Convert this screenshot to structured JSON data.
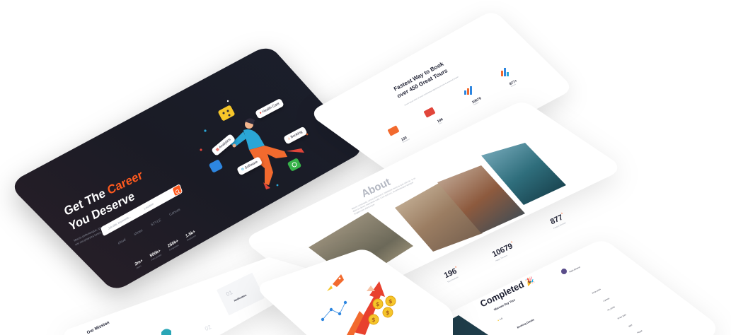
{
  "hero": {
    "title_line1": "Get The ",
    "title_accent": "Career",
    "title_line2": "You Deserve",
    "subtitle": "Mauris pellentesque, ipsum eu pulvinar laoreet, lacus lorem semper dapibus, nisi nisl pharetra lorem, nec dictum arcu nisl eget magna.",
    "search_placeholder": "Job title, keywords...",
    "location_placeholder": "Location",
    "search_icon": "search-icon",
    "brands": [
      "cloud",
      "shoes",
      "STYLE",
      "Canvas"
    ],
    "stats": [
      {
        "num": "2m+",
        "label": "Users"
      },
      {
        "num": "500k+",
        "label": "Jobs posted"
      },
      {
        "num": "250k+",
        "label": "Companies"
      },
      {
        "num": "1.5k+",
        "label": "Employers"
      }
    ],
    "tags": [
      "Health Care",
      "Booking",
      "Analytics",
      "Software"
    ]
  },
  "tour": {
    "title_line1": "Fastest Way to Book",
    "title_line2": "over 450 Great Tours",
    "subtitle": "Lorem ipsum dolor sit amet consectetur adipiscing elit sed do eiusmod tempor",
    "stats": [
      {
        "num": "130",
        "label": "Destinations"
      },
      {
        "num": "196",
        "label": "Tours"
      },
      {
        "num": "10679",
        "label": "Travelers"
      },
      {
        "num": "877+",
        "label": "Reviews"
      }
    ]
  },
  "about": {
    "title": "About",
    "subtitle": "Mauris consequat, cursus pharetra et, habitasse rhoncus quis odio ac. In et dolor eu donec maecenas nulla. Cum sed orci, sit pellentesque quisque feugiat cras ullamcorper.",
    "stats": [
      {
        "num": "196",
        "sup": "+",
        "label": "Tours Available"
      },
      {
        "num": "10679",
        "sup": "+",
        "label": "Happy Travelers"
      },
      {
        "num": "877",
        "sup": "+",
        "label": "Positive Reviews"
      }
    ]
  },
  "mission": {
    "title": "Our Mission",
    "step_num1": "01",
    "step_title1": "Notification",
    "step_num2": "02"
  },
  "completed": {
    "title": "Completed",
    "emoji": "🎉",
    "tour_name": "Warsaw Day Tour",
    "rating": "4.8",
    "section": "Booking Details",
    "detail_values": [
      "15 Apr 2024",
      "2 guests",
      "#A_12345",
      "15 Apr 2024",
      "$287",
      "Paypal"
    ],
    "user_name": "Ralph Edwards"
  },
  "colors": {
    "accent": "#ff5a1f",
    "dark_bg": "#1a1c26"
  }
}
